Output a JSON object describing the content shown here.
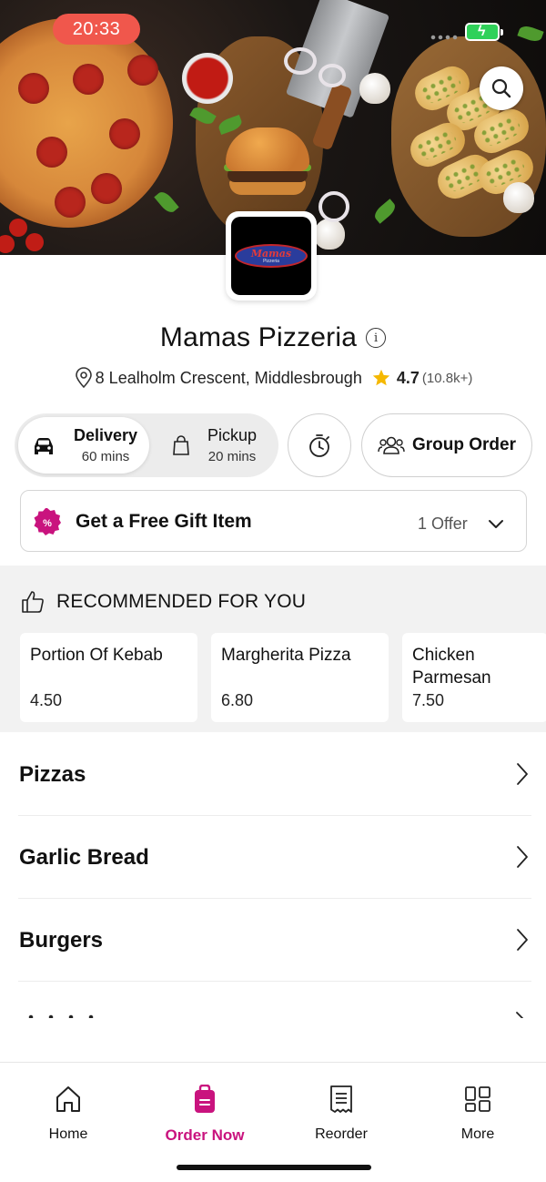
{
  "status_bar": {
    "time": "20:33"
  },
  "restaurant": {
    "name": "Mamas Pizzeria",
    "logo_text": "Mamas",
    "logo_subtext": "Pizzeria",
    "address": "8 Lealholm Crescent, Middlesbrough",
    "rating": "4.7",
    "rating_count": "(10.8k+)"
  },
  "order_mode": {
    "delivery": {
      "label": "Delivery",
      "time": "60 mins"
    },
    "pickup": {
      "label": "Pickup",
      "time": "20 mins"
    },
    "selected": "delivery"
  },
  "group_order_label": "Group Order",
  "offer": {
    "title": "Get a Free Gift Item",
    "count": "1 Offer"
  },
  "recommended": {
    "heading": "RECOMMENDED FOR YOU",
    "items": [
      {
        "name": "Portion Of Kebab",
        "price": "4.50"
      },
      {
        "name": "Margherita Pizza",
        "price": "6.80"
      },
      {
        "name": "Chicken Parmesan",
        "price": "7.50"
      }
    ]
  },
  "categories": [
    "Pizzas",
    "Garlic Bread",
    "Burgers"
  ],
  "tabbar": {
    "items": [
      {
        "label": "Home",
        "icon": "home-icon"
      },
      {
        "label": "Order Now",
        "icon": "order-bag-icon"
      },
      {
        "label": "Reorder",
        "icon": "receipt-icon"
      },
      {
        "label": "More",
        "icon": "grid-icon"
      }
    ],
    "active": "Order Now"
  },
  "colors": {
    "accent": "#c9137e",
    "status_pill": "#f0574c",
    "battery": "#2fd159",
    "star": "#f5b800"
  }
}
